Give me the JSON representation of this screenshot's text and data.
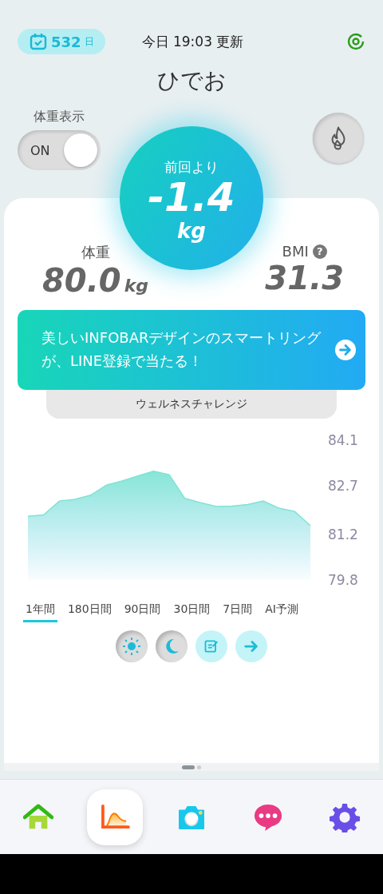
{
  "header": {
    "streak_days": "532",
    "streak_unit": "日",
    "updated": "今日 19:03 更新",
    "user_name": "ひでお"
  },
  "weight_toggle": {
    "label": "体重表示",
    "state_text": "ON",
    "on": true
  },
  "change": {
    "label": "前回より",
    "value": "-1.4",
    "unit": "kg"
  },
  "weight": {
    "label": "体重",
    "value": "80.0",
    "unit": "kg"
  },
  "bmi": {
    "label": "BMI",
    "help": "?",
    "value": "31.3"
  },
  "banner": {
    "text": "美しいINFOBARデザインのスマートリングが、LINE登録で当たる！",
    "tab": "ウェルネスチャレンジ"
  },
  "chart": {
    "chart_data": {
      "type": "area",
      "ylim": [
        79.8,
        84.1
      ],
      "yticks": [
        79.8,
        81.2,
        82.7,
        84.1
      ],
      "categories": [
        null,
        null,
        null,
        null,
        null,
        null,
        null,
        null,
        null,
        null,
        null,
        null,
        null,
        null,
        null,
        null,
        null,
        null,
        null
      ],
      "series": [
        {
          "color": "#7fe3d3",
          "values": [
            81.76,
            81.8,
            82.23,
            82.28,
            82.41,
            82.72,
            82.85,
            83.0,
            83.15,
            83.04,
            82.31,
            82.18,
            82.06,
            82.07,
            82.12,
            82.23,
            82.01,
            81.91,
            81.47
          ]
        }
      ]
    }
  },
  "periods": [
    {
      "label": "1年間",
      "selected": true
    },
    {
      "label": "180日間",
      "selected": false
    },
    {
      "label": "90日間",
      "selected": false
    },
    {
      "label": "30日間",
      "selected": false
    },
    {
      "label": "7日間",
      "selected": false
    },
    {
      "label": "AI予測",
      "selected": false
    }
  ],
  "filters": [
    {
      "kind": "sun",
      "selected": true
    },
    {
      "kind": "moon",
      "selected": true
    },
    {
      "kind": "note",
      "selected": false
    },
    {
      "kind": "arrow",
      "selected": false
    }
  ],
  "nav": [
    {
      "kind": "home",
      "selected": false
    },
    {
      "kind": "graph",
      "selected": true
    },
    {
      "kind": "camera",
      "selected": false
    },
    {
      "kind": "chat",
      "selected": false
    },
    {
      "kind": "settings",
      "selected": false
    }
  ]
}
